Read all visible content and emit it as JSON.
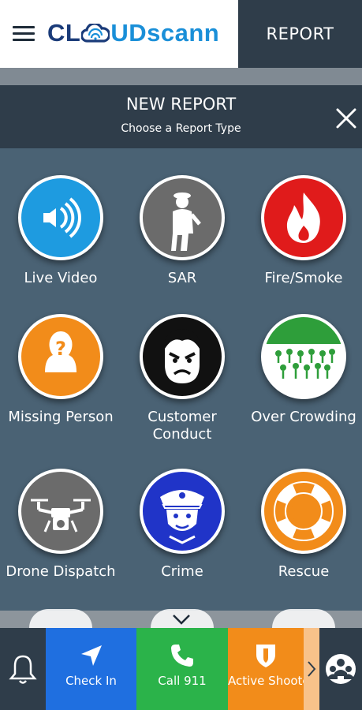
{
  "header": {
    "menu_icon": "hamburger-icon",
    "logo_text_a": "CL",
    "logo_text_b": "UDSCANN",
    "logo_text_b_display": "UDscann",
    "logo_icon": "cloud-wifi-icon",
    "report_tab_label": "REPORT"
  },
  "modal": {
    "title": "NEW REPORT",
    "subtitle": "Choose a Report Type",
    "close_icon": "close-icon"
  },
  "report_types": [
    {
      "label": "Live Video",
      "icon": "live-video-icon",
      "color": "#1e9be0"
    },
    {
      "label": "SAR",
      "icon": "sar-icon",
      "color": "#6b6b6b"
    },
    {
      "label": "Fire/Smoke",
      "icon": "fire-icon",
      "color": "#e01b1b"
    },
    {
      "label": "Missing Person",
      "icon": "missing-person-icon",
      "color": "#f28c1a"
    },
    {
      "label": "Customer Conduct",
      "label_line1": "Customer",
      "label_line2": "Conduct",
      "icon": "angry-face-icon",
      "color": "#111111"
    },
    {
      "label": "Over Crowding",
      "icon": "crowd-icon",
      "color": "#2e9e3a"
    },
    {
      "label": "Drone Dispatch",
      "icon": "drone-icon",
      "color": "#6b6b6b"
    },
    {
      "label": "Crime",
      "icon": "police-officer-icon",
      "color": "#2034c8"
    },
    {
      "label": "Rescue",
      "icon": "lifebuoy-icon",
      "color": "#f28c1a"
    }
  ],
  "bottom_bar": {
    "notifications_icon": "bell-icon",
    "actions": [
      {
        "label": "Check In",
        "icon": "navigation-arrow-icon",
        "color": "#1f6fe0"
      },
      {
        "label": "Call 911",
        "icon": "phone-icon",
        "color": "#2bb34a"
      },
      {
        "label": "Active Shooter",
        "icon": "shield-icon",
        "color": "#f28c1a"
      }
    ],
    "more_icon": "chevron-right-icon",
    "team_icon": "team-icon"
  },
  "colors": {
    "header_dark": "#2f3d4a",
    "background": "#4a6274",
    "logo_dark_blue": "#1a3b79",
    "logo_light_blue": "#1a8fd8"
  }
}
